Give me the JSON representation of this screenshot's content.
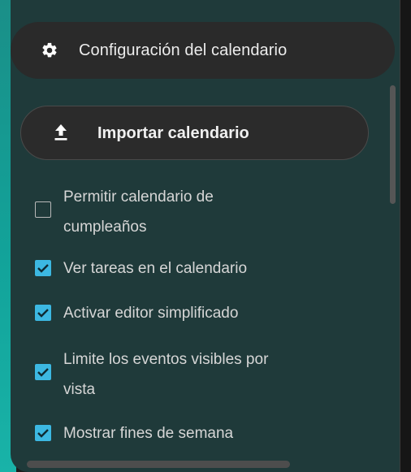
{
  "settings": {
    "title": "Configuración del calendario",
    "icon": "gear-icon"
  },
  "import_button": {
    "label": "Importar calendario",
    "icon": "upload-icon"
  },
  "options": [
    {
      "label_lines": [
        "Permitir calendario de",
        "cumpleaños"
      ],
      "checked": false
    },
    {
      "label_lines": [
        "Ver tareas en el calendario"
      ],
      "checked": true
    },
    {
      "label_lines": [
        "Activar editor simplificado"
      ],
      "checked": true
    },
    {
      "label_lines": [
        "Limite los eventos visibles por",
        "vista"
      ],
      "checked": true
    },
    {
      "label_lines": [
        "Mostrar fines de semana"
      ],
      "checked": true
    }
  ],
  "colors": {
    "panel_bg": "#1f3a3a",
    "header_bg": "#2a2a2a",
    "checkbox_checked": "#3cb8e2",
    "accent_strip": "#12a39a"
  }
}
